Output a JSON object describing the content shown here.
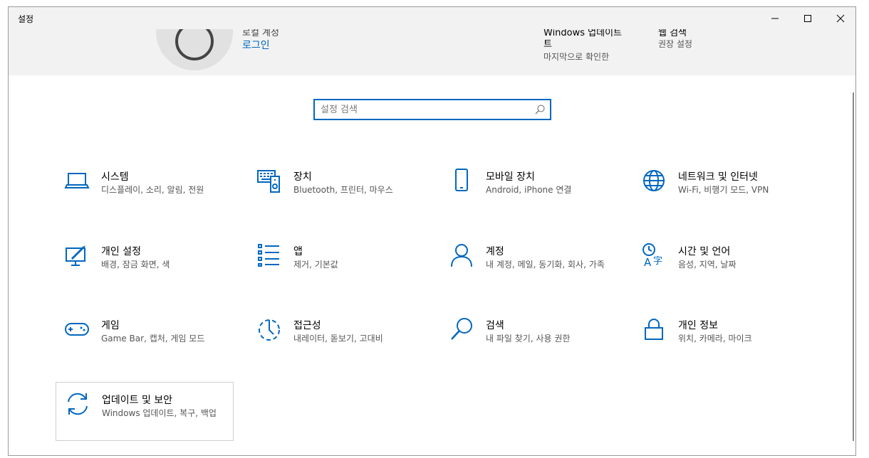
{
  "window": {
    "title": "설정"
  },
  "header": {
    "account_top": "로컬 계정",
    "account_link": "로그인",
    "update_title_line1": "Windows 업데이트",
    "update_title_line2": "트",
    "update_sub": "마지막으로 확인한",
    "rewards_title": "웹 검색",
    "rewards_sub": "권장 설정"
  },
  "search": {
    "placeholder": "설정 검색",
    "value": ""
  },
  "tiles": [
    {
      "title": "시스템",
      "desc": "디스플레이, 소리, 알림, 전원",
      "icon": "laptop-icon"
    },
    {
      "title": "장치",
      "desc": "Bluetooth, 프린터, 마우스",
      "icon": "devices-icon"
    },
    {
      "title": "모바일 장치",
      "desc": "Android, iPhone 연결",
      "icon": "phone-icon"
    },
    {
      "title": "네트워크 및 인터넷",
      "desc": "Wi-Fi, 비행기 모드, VPN",
      "icon": "globe-icon"
    },
    {
      "title": "개인 설정",
      "desc": "배경, 잠금 화면, 색",
      "icon": "personalization-icon"
    },
    {
      "title": "앱",
      "desc": "제거, 기본값",
      "icon": "apps-icon"
    },
    {
      "title": "계정",
      "desc": "내 계정, 메일, 동기화, 회사, 가족",
      "icon": "person-icon"
    },
    {
      "title": "시간 및 언어",
      "desc": "음성, 지역, 날짜",
      "icon": "time-language-icon"
    },
    {
      "title": "게임",
      "desc": "Game Bar, 캡처, 게임 모드",
      "icon": "gamepad-icon"
    },
    {
      "title": "접근성",
      "desc": "내레이터, 돋보기, 고대비",
      "icon": "accessibility-icon"
    },
    {
      "title": "검색",
      "desc": "내 파일 찾기, 사용 권한",
      "icon": "search-icon"
    },
    {
      "title": "개인 정보",
      "desc": "위치, 카메라, 마이크",
      "icon": "lock-icon"
    },
    {
      "title": "업데이트 및 보안",
      "desc": "Windows 업데이트, 복구, 백업",
      "icon": "update-icon"
    }
  ],
  "colors": {
    "accent": "#0067c0",
    "header_bg": "#f2f2f2"
  }
}
